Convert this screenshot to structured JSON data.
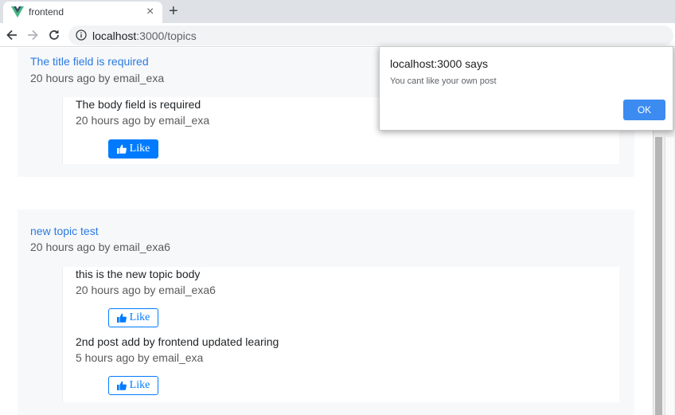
{
  "browser": {
    "tab_title": "frontend",
    "close_glyph": "×",
    "new_tab_glyph": "+",
    "url_host": "localhost",
    "url_path": ":3000/topics"
  },
  "topics": [
    {
      "title": "The title field is required",
      "meta": "20 hours ago by email_exa",
      "posts": [
        {
          "body": "The body field is required",
          "meta": "20 hours ago by email_exa",
          "like_label": "Like",
          "style": "filled"
        }
      ]
    },
    {
      "title": "new topic test",
      "meta": "20 hours ago by email_exa6",
      "posts": [
        {
          "body": "this is the new topic body",
          "meta": "20 hours ago by email_exa6",
          "like_label": "Like",
          "style": "outline"
        },
        {
          "body": "2nd post add by frontend updated learing",
          "meta": "5 hours ago by email_exa",
          "like_label": "Like",
          "style": "outline"
        }
      ]
    }
  ],
  "dialog": {
    "title": "localhost:3000 says",
    "message": "You cant like your own post",
    "ok_label": "OK"
  },
  "colors": {
    "link": "#2a7ae2",
    "primary": "#007bff",
    "dialog_ok": "#3c8bf0"
  },
  "icons": [
    "vue-logo-icon",
    "close-icon",
    "plus-icon",
    "back-arrow-icon",
    "forward-arrow-icon",
    "reload-icon",
    "info-icon",
    "thumbs-up-icon"
  ]
}
